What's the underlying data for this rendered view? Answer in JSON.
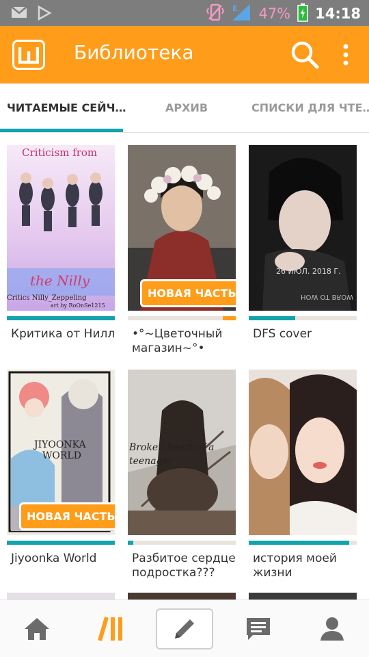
{
  "status_bar": {
    "battery_percent": "47%",
    "time": "14:18"
  },
  "app_bar": {
    "title": "Библиотека"
  },
  "tabs": [
    {
      "label": "ЧИТАЕМЫЕ СЕЙЧ…"
    },
    {
      "label": "АРХИВ"
    },
    {
      "label": "СПИСКИ ДЛЯ ЧТЕ…"
    }
  ],
  "books": [
    {
      "title": "Критика от Нилл",
      "cover_text": [
        "Criticism from",
        "the Nilly",
        "Critics Nilly_Zeppeling",
        "art by RoOnSe1215"
      ],
      "progress": 1.0,
      "badge": ""
    },
    {
      "title": "•°~Цветочный магазин~°•",
      "cover_text": [],
      "progress": 0.12,
      "badge": "НОВАЯ ЧАСТЬ"
    },
    {
      "title": "DFS cover",
      "cover_text": [
        "26 ИЮЛ. 2018 Г.",
        "HOW OT BROW"
      ],
      "progress": 0.43,
      "badge": ""
    },
    {
      "title": "Jiyoonka World",
      "cover_text": [
        "JIYOONKA",
        "WORLD"
      ],
      "progress": 1.0,
      "badge": "НОВАЯ ЧАСТЬ"
    },
    {
      "title": "Разбитое сердце подростка???",
      "cover_text": [
        "Broken heart of a",
        "teenager"
      ],
      "progress": 0.05,
      "badge": ""
    },
    {
      "title": "история моей жизни",
      "cover_text": [],
      "progress": 0.93,
      "badge": ""
    }
  ],
  "bottom_nav": [
    {
      "icon": "home-icon"
    },
    {
      "icon": "library-icon"
    },
    {
      "icon": "pencil-icon"
    },
    {
      "icon": "messages-icon"
    },
    {
      "icon": "profile-icon"
    }
  ],
  "colors": {
    "brand_orange": "#ff9c1a",
    "accent_teal": "#12a3ad",
    "status_gray": "#7d7d7d"
  }
}
